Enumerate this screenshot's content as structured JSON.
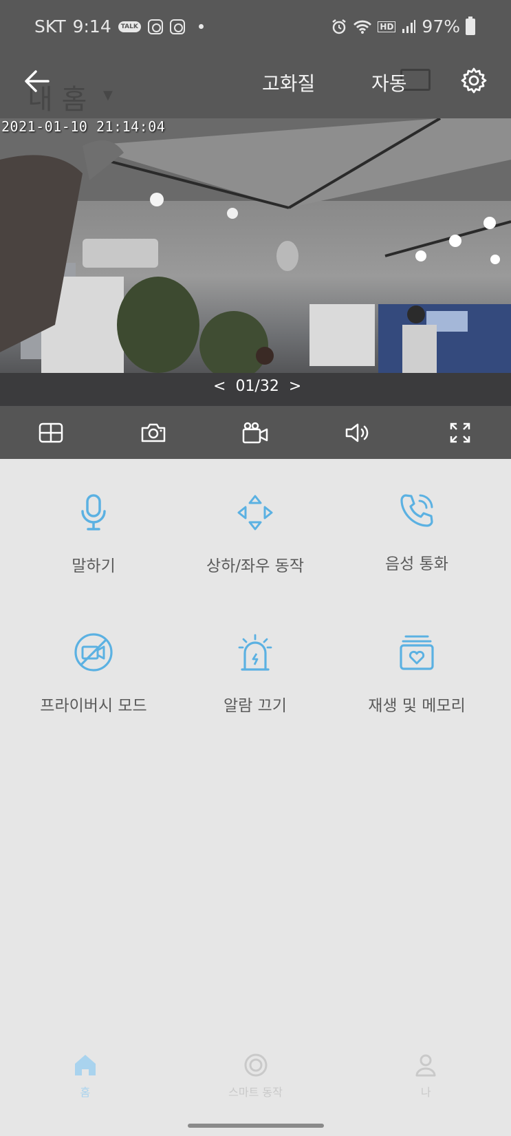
{
  "status_bar": {
    "carrier": "SKT",
    "time": "9:14",
    "talk_badge": "TALK",
    "hd_badge": "HD",
    "battery": "97%"
  },
  "background_header": {
    "home_title": "내 홈"
  },
  "header": {
    "quality_label": "고화질",
    "mode_label": "자동"
  },
  "video": {
    "timestamp": "2021-01-10  21:14:04",
    "page_prev": "<",
    "page_indicator": "01/32",
    "page_next": ">"
  },
  "controls": [
    "layout-grid-icon",
    "camera-icon",
    "video-record-icon",
    "speaker-icon",
    "fullscreen-icon"
  ],
  "features": [
    {
      "label": "말하기",
      "icon": "microphone-icon"
    },
    {
      "label": "상하/좌우 동작",
      "icon": "pan-tilt-arrows-icon"
    },
    {
      "label": "음성 통화",
      "icon": "phone-call-icon"
    },
    {
      "label": "프라이버시 모드",
      "icon": "privacy-camera-off-icon"
    },
    {
      "label": "알람 끄기",
      "icon": "alarm-siren-icon"
    },
    {
      "label": "재생 및 메모리",
      "icon": "playback-memory-icon"
    }
  ],
  "bottom_nav": {
    "items": [
      {
        "label": "홈",
        "icon": "home-icon",
        "active": true
      },
      {
        "label": "스마트 동작",
        "icon": "smart-action-icon",
        "active": false
      },
      {
        "label": "나",
        "icon": "profile-icon",
        "active": false
      }
    ]
  },
  "colors": {
    "accent": "#5bb1e2",
    "nav_active": "#a9d3ee",
    "nav_inactive": "#c9c9c9",
    "page_bg": "#e6e6e6",
    "control_bar": "#555555"
  }
}
